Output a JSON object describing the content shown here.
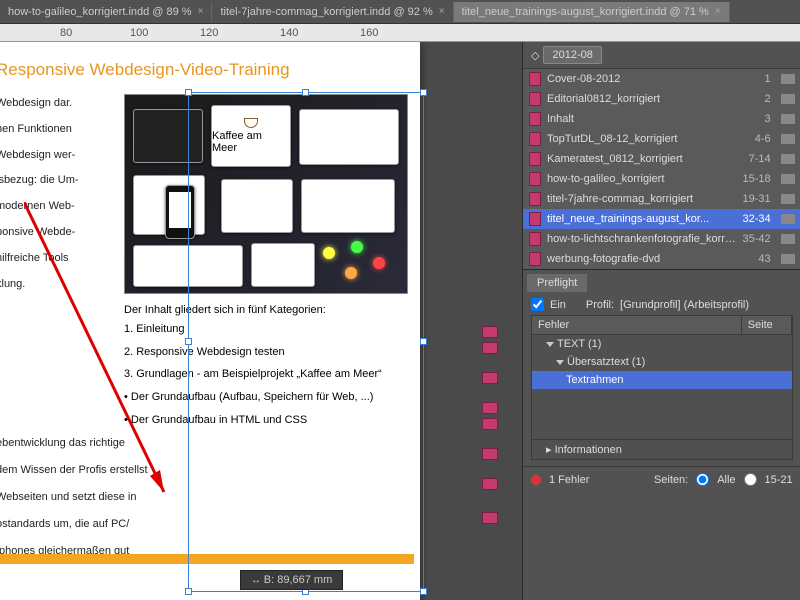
{
  "tabs": [
    {
      "label": "how-to-galileo_korrigiert.indd @ 89 %",
      "active": false
    },
    {
      "label": "titel-7jahre-commag_korrigiert.indd @ 92 %",
      "active": false
    },
    {
      "label": "titel_neue_trainings-august_korrigiert.indd @ 71 %",
      "active": true
    }
  ],
  "ruler": {
    "t0": "80",
    "t1": "100",
    "t2": "120",
    "t3": "140",
    "t4": "160"
  },
  "doc": {
    "title": "Responsive Webdesign-Video-Training",
    "col1a": "Webdesign dar.",
    "col1b": "hen Funktionen",
    "col1c": "Webdesign wer-",
    "col1d": "isbezug: die Um-",
    "col1e": "modernen Web-",
    "col1f": "ponsive Webde-",
    "col1g": "hilfreiche Tools",
    "col1h": "klung.",
    "col1i": "ebentwicklung das richtige",
    "col1j": "dem Wissen der Profis erstellst",
    "col1k": "Webseiten und setzt diese in",
    "col1l": "ostandards um, die auf PC/",
    "col1m": "tphones gleichermaßen gut",
    "kaffee": "Kaffee am Meer",
    "subTitle": "Der Inhalt gliedert sich in fünf Kategorien:",
    "li1": "1. Einleitung",
    "li2": "2. Responsive Webdesign testen",
    "li3": "3. Grundlagen - am Beispielprojekt „Kaffee am Meer“",
    "li4": "• Der Grundaufbau (Aufbau, Speichern für Web, ...)",
    "li5": "• Der Grundaufbau in HTML und CSS"
  },
  "status": {
    "width": "B: 89,667 mm"
  },
  "book": {
    "label": "2012-08"
  },
  "pages": [
    {
      "name": "Cover-08-2012",
      "range": "1"
    },
    {
      "name": "Editorial0812_korrigiert",
      "range": "2"
    },
    {
      "name": "Inhalt",
      "range": "3"
    },
    {
      "name": "TopTutDL_08-12_korrigiert",
      "range": "4-6"
    },
    {
      "name": "Kameratest_0812_korrigiert",
      "range": "7-14"
    },
    {
      "name": "how-to-galileo_korrigiert",
      "range": "15-18"
    },
    {
      "name": "titel-7jahre-commag_korrigiert",
      "range": "19-31"
    },
    {
      "name": "titel_neue_trainings-august_kor...",
      "range": "32-34",
      "selected": true
    },
    {
      "name": "how-to-lichtschrankenfotografie_korrigiert",
      "range": "35-42"
    },
    {
      "name": "werbung-fotografie-dvd",
      "range": "43"
    }
  ],
  "preflight": {
    "tab": "Preflight",
    "ein": "Ein",
    "profilLabel": "Profil:",
    "profilValue": "[Grundprofil] (Arbeitsprofil)",
    "colError": "Fehler",
    "colPage": "Seite",
    "text1": "TEXT (1)",
    "ubersatz": "Übersatztext (1)",
    "textrahmen": "Textrahmen",
    "info": "Informationen",
    "errCount": "1 Fehler",
    "seiten": "Seiten:",
    "alle": "Alle",
    "range": "15-21"
  }
}
